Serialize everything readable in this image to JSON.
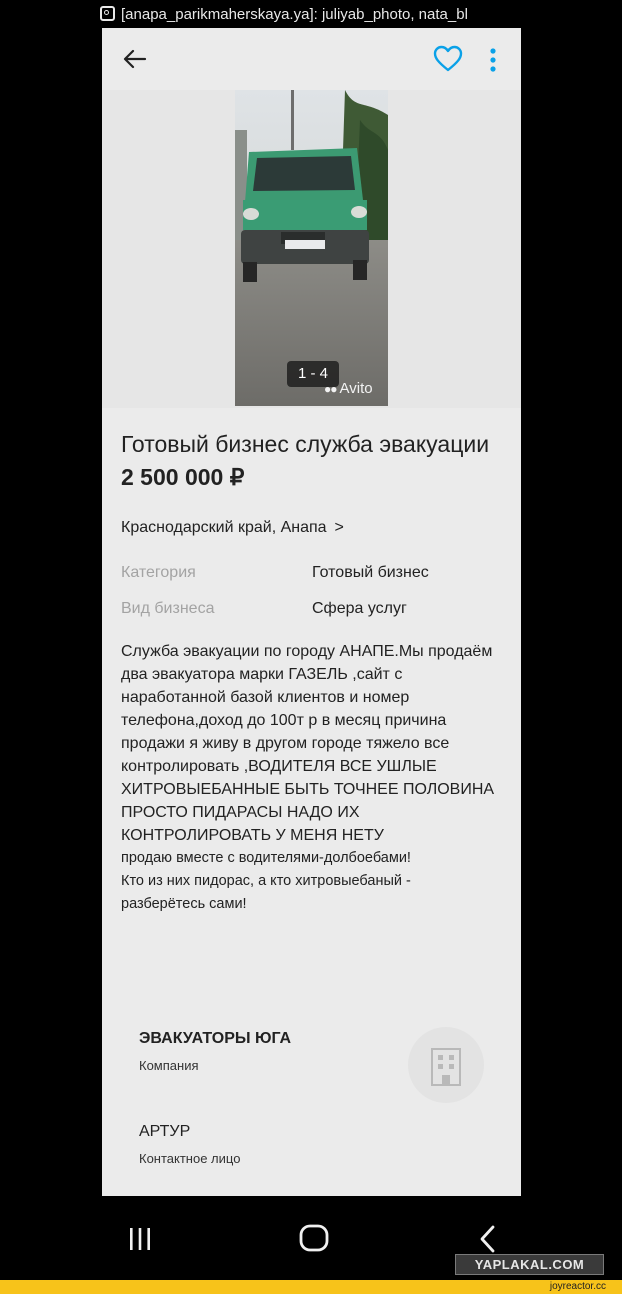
{
  "credit": {
    "icon": "instagram-icon",
    "text": "[anapa_parikmaherskaya.ya]: juliyab_photo, nata_bl"
  },
  "topbar": {
    "back_icon": "arrow-left-icon",
    "favorite_icon": "heart-icon",
    "menu_icon": "more-vertical-icon",
    "accent": "#0aa1e8"
  },
  "gallery": {
    "counter": "1 - 4",
    "brand": "Avito"
  },
  "listing": {
    "title": "Готовый бизнес служба эвакуации",
    "price": "2 500 000 ₽",
    "location": "Краснодарский край, Анапа",
    "location_chevron": ">",
    "params": [
      {
        "key": "Категория",
        "value": "Готовый бизнес"
      },
      {
        "key": "Вид бизнеса",
        "value": "Сфера услуг"
      }
    ],
    "description": "Служба эвакуации по городу АНАПЕ.Мы продаём два эвакуатора марки ГАЗЕЛЬ ,сайт с наработанной базой клиентов и номер телефона,доход до 100т р в месяц причина продажи я живу в другом городе тяжело все контролировать ,ВОДИТЕЛЯ ВСЕ УШЛЫЕ ХИТРОВЫЕБАННЫЕ БЫТЬ ТОЧНЕЕ ПОЛОВИНА ПРОСТО ПИДАРАСЫ НАДО ИХ КОНТРОЛИРОВАТЬ У МЕНЯ НЕТУ",
    "description_addendum": "продаю вместе с водителями-долбоебами! Кто из них пидорас, а кто хитровыебаный - разберётесь сами!"
  },
  "seller": {
    "name": "ЭВАКУАТОРЫ ЮГА",
    "type": "Компания",
    "icon": "building-icon"
  },
  "contact": {
    "name": "АРТУР",
    "role": "Контактное лицо"
  },
  "navbar": {
    "recents_icon": "recent-apps-icon",
    "home_icon": "home-icon",
    "back_icon": "chevron-left-icon"
  },
  "watermarks": {
    "yaplakal": "YAPLAKAL.COM",
    "joyreactor": "joyreactor.cc"
  }
}
